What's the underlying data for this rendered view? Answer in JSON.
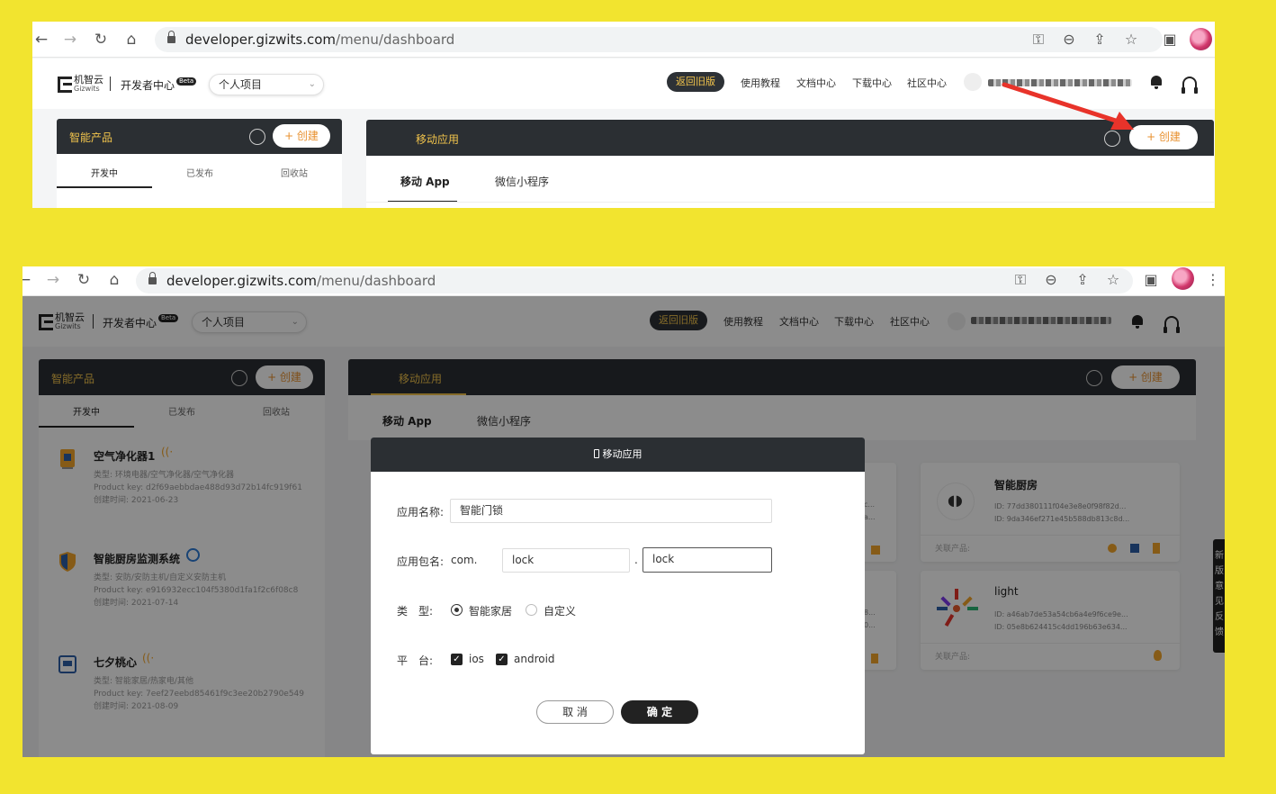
{
  "browser": {
    "url_host": "developer.gizwits.com",
    "url_path": "/menu/dashboard"
  },
  "header": {
    "logo_cn": "机智云",
    "logo_en": "Gizwits",
    "dev_center": "开发者中心",
    "beta": "Beta",
    "project_select": "个人项目",
    "old_version": "返回旧版",
    "nav": [
      "使用教程",
      "文档中心",
      "下载中心",
      "社区中心"
    ]
  },
  "left_panel": {
    "title": "智能产品",
    "create_label": "+ 创建",
    "tabs": [
      "开发中",
      "已发布",
      "回收站"
    ],
    "products": [
      {
        "name": "空气净化器1",
        "type": "类型: 环境电器/空气净化器/空气净化器",
        "key": "Product key: d2f69aebbdae488d93d72b14fc919f61",
        "time": "创建时间: 2021-06-23"
      },
      {
        "name": "智能厨房监测系统",
        "type": "类型: 安防/安防主机/自定义安防主机",
        "key": "Product key: e916932ecc104f5380d1fa1f2c6f08c8",
        "time": "创建时间: 2021-07-14"
      },
      {
        "name": "七夕桃心",
        "type": "类型: 智能家居/热家电/其他",
        "key": "Product key: 7eef27eebd85461f9c3ee20b2790e549",
        "time": "创建时间: 2021-08-09"
      }
    ]
  },
  "right_panel": {
    "title": "移动应用",
    "create_label": "+ 创建",
    "tabs": [
      "移动 App",
      "微信小程序"
    ],
    "cards": [
      {
        "name": "智能厨房",
        "id1": "ID: 77dd380111f04e3e8e0f98f82d...",
        "id2": "ID: 9da346ef271e45b588db813c8d...",
        "related": "关联产品:"
      },
      {
        "name": "light",
        "id1": "ID: a46ab7de53a54cb6a4e9f6ce9e...",
        "id2": "ID: 05e8b624415c4dd196b63e634...",
        "related": "关联产品:"
      }
    ],
    "partial_ids": [
      "c...",
      "a...",
      "8...",
      "0..."
    ]
  },
  "modal": {
    "title": "移动应用",
    "name_label": "应用名称:",
    "name_value": "智能门锁",
    "package_label": "应用包名:",
    "package_prefix": "com.",
    "package_part1": "lock",
    "package_dot": ".",
    "package_part2": "lock",
    "type_label": "类　型:",
    "type_options": [
      "智能家居",
      "自定义"
    ],
    "type_selected": "智能家居",
    "platform_label": "平　台:",
    "platforms": [
      "ios",
      "android"
    ],
    "cancel": "取 消",
    "confirm": "确 定"
  },
  "side_tab_chars": [
    "新",
    "版",
    "意",
    "见",
    "反",
    "馈"
  ],
  "colors": {
    "background": "#f2e42f",
    "dark_bar": "#2b2f33",
    "accent_gold": "#f2c44c",
    "create_orange": "#e8912f",
    "arrow_red": "#e8332a"
  }
}
